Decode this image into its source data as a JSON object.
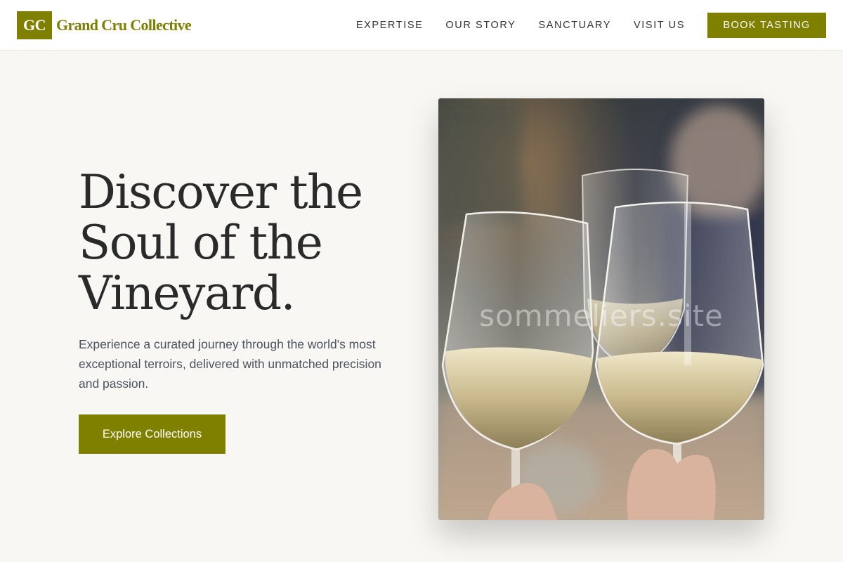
{
  "brand": {
    "logo_mark": "GC",
    "name": "Grand Cru Collective",
    "color": "#7f7f00"
  },
  "nav": {
    "items": [
      {
        "label": "EXPERTISE"
      },
      {
        "label": "OUR STORY"
      },
      {
        "label": "SANCTUARY"
      },
      {
        "label": "VISIT US"
      }
    ],
    "cta_label": "BOOK TASTING"
  },
  "hero": {
    "title_lines": [
      "Discover the",
      "Soul of the",
      "Vineyard."
    ],
    "subtitle": "Experience a curated journey through the world's most exceptional terroirs, delivered with unmatched precision and passion.",
    "cta_label": "Explore Collections",
    "image": {
      "subject": "hands toasting with glasses of white wine",
      "watermark": "sommeliers.site"
    }
  },
  "colors": {
    "accent": "#7f7f00",
    "background": "#f8f7f3",
    "header_bg": "#ffffff",
    "title_text": "#2a2a2a",
    "body_text": "#4d5260"
  }
}
